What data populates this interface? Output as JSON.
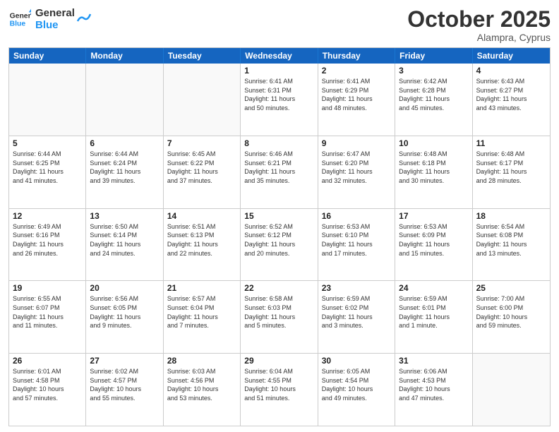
{
  "header": {
    "logo_general": "General",
    "logo_blue": "Blue",
    "month": "October 2025",
    "location": "Alampra, Cyprus"
  },
  "days_of_week": [
    "Sunday",
    "Monday",
    "Tuesday",
    "Wednesday",
    "Thursday",
    "Friday",
    "Saturday"
  ],
  "weeks": [
    [
      {
        "day": "",
        "info": ""
      },
      {
        "day": "",
        "info": ""
      },
      {
        "day": "",
        "info": ""
      },
      {
        "day": "1",
        "info": "Sunrise: 6:41 AM\nSunset: 6:31 PM\nDaylight: 11 hours\nand 50 minutes."
      },
      {
        "day": "2",
        "info": "Sunrise: 6:41 AM\nSunset: 6:29 PM\nDaylight: 11 hours\nand 48 minutes."
      },
      {
        "day": "3",
        "info": "Sunrise: 6:42 AM\nSunset: 6:28 PM\nDaylight: 11 hours\nand 45 minutes."
      },
      {
        "day": "4",
        "info": "Sunrise: 6:43 AM\nSunset: 6:27 PM\nDaylight: 11 hours\nand 43 minutes."
      }
    ],
    [
      {
        "day": "5",
        "info": "Sunrise: 6:44 AM\nSunset: 6:25 PM\nDaylight: 11 hours\nand 41 minutes."
      },
      {
        "day": "6",
        "info": "Sunrise: 6:44 AM\nSunset: 6:24 PM\nDaylight: 11 hours\nand 39 minutes."
      },
      {
        "day": "7",
        "info": "Sunrise: 6:45 AM\nSunset: 6:22 PM\nDaylight: 11 hours\nand 37 minutes."
      },
      {
        "day": "8",
        "info": "Sunrise: 6:46 AM\nSunset: 6:21 PM\nDaylight: 11 hours\nand 35 minutes."
      },
      {
        "day": "9",
        "info": "Sunrise: 6:47 AM\nSunset: 6:20 PM\nDaylight: 11 hours\nand 32 minutes."
      },
      {
        "day": "10",
        "info": "Sunrise: 6:48 AM\nSunset: 6:18 PM\nDaylight: 11 hours\nand 30 minutes."
      },
      {
        "day": "11",
        "info": "Sunrise: 6:48 AM\nSunset: 6:17 PM\nDaylight: 11 hours\nand 28 minutes."
      }
    ],
    [
      {
        "day": "12",
        "info": "Sunrise: 6:49 AM\nSunset: 6:16 PM\nDaylight: 11 hours\nand 26 minutes."
      },
      {
        "day": "13",
        "info": "Sunrise: 6:50 AM\nSunset: 6:14 PM\nDaylight: 11 hours\nand 24 minutes."
      },
      {
        "day": "14",
        "info": "Sunrise: 6:51 AM\nSunset: 6:13 PM\nDaylight: 11 hours\nand 22 minutes."
      },
      {
        "day": "15",
        "info": "Sunrise: 6:52 AM\nSunset: 6:12 PM\nDaylight: 11 hours\nand 20 minutes."
      },
      {
        "day": "16",
        "info": "Sunrise: 6:53 AM\nSunset: 6:10 PM\nDaylight: 11 hours\nand 17 minutes."
      },
      {
        "day": "17",
        "info": "Sunrise: 6:53 AM\nSunset: 6:09 PM\nDaylight: 11 hours\nand 15 minutes."
      },
      {
        "day": "18",
        "info": "Sunrise: 6:54 AM\nSunset: 6:08 PM\nDaylight: 11 hours\nand 13 minutes."
      }
    ],
    [
      {
        "day": "19",
        "info": "Sunrise: 6:55 AM\nSunset: 6:07 PM\nDaylight: 11 hours\nand 11 minutes."
      },
      {
        "day": "20",
        "info": "Sunrise: 6:56 AM\nSunset: 6:05 PM\nDaylight: 11 hours\nand 9 minutes."
      },
      {
        "day": "21",
        "info": "Sunrise: 6:57 AM\nSunset: 6:04 PM\nDaylight: 11 hours\nand 7 minutes."
      },
      {
        "day": "22",
        "info": "Sunrise: 6:58 AM\nSunset: 6:03 PM\nDaylight: 11 hours\nand 5 minutes."
      },
      {
        "day": "23",
        "info": "Sunrise: 6:59 AM\nSunset: 6:02 PM\nDaylight: 11 hours\nand 3 minutes."
      },
      {
        "day": "24",
        "info": "Sunrise: 6:59 AM\nSunset: 6:01 PM\nDaylight: 11 hours\nand 1 minute."
      },
      {
        "day": "25",
        "info": "Sunrise: 7:00 AM\nSunset: 6:00 PM\nDaylight: 10 hours\nand 59 minutes."
      }
    ],
    [
      {
        "day": "26",
        "info": "Sunrise: 6:01 AM\nSunset: 4:58 PM\nDaylight: 10 hours\nand 57 minutes."
      },
      {
        "day": "27",
        "info": "Sunrise: 6:02 AM\nSunset: 4:57 PM\nDaylight: 10 hours\nand 55 minutes."
      },
      {
        "day": "28",
        "info": "Sunrise: 6:03 AM\nSunset: 4:56 PM\nDaylight: 10 hours\nand 53 minutes."
      },
      {
        "day": "29",
        "info": "Sunrise: 6:04 AM\nSunset: 4:55 PM\nDaylight: 10 hours\nand 51 minutes."
      },
      {
        "day": "30",
        "info": "Sunrise: 6:05 AM\nSunset: 4:54 PM\nDaylight: 10 hours\nand 49 minutes."
      },
      {
        "day": "31",
        "info": "Sunrise: 6:06 AM\nSunset: 4:53 PM\nDaylight: 10 hours\nand 47 minutes."
      },
      {
        "day": "",
        "info": ""
      }
    ]
  ]
}
